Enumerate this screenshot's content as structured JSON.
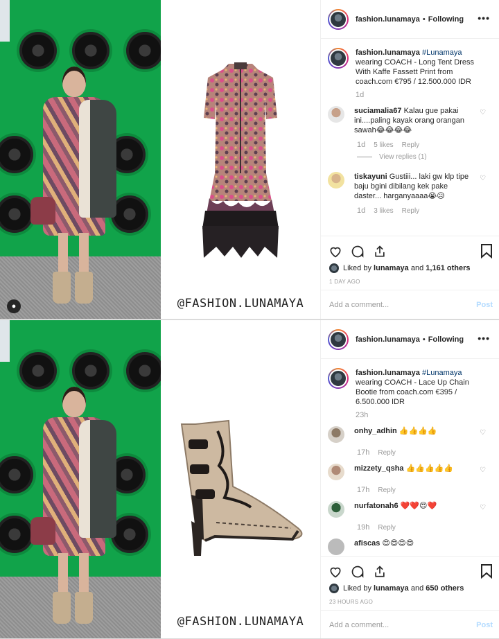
{
  "posts": [
    {
      "header": {
        "username": "fashion.lunamaya",
        "separator": "•",
        "follow_status": "Following",
        "more": "•••"
      },
      "watermark": "@FASHION.LUNAMAYA",
      "caption": {
        "username": "fashion.lunamaya",
        "hashtag": "#Lunamaya",
        "text": "wearing COACH - Long Tent Dress With Kaffe Fassett Print from coach.com €795 / 12.500.000 IDR",
        "time": "1d"
      },
      "comments": [
        {
          "username": "suciamalia67",
          "text": "Kalau gue pakai ini....paling kayak orang orangan sawah😂😂😂😂",
          "time": "1d",
          "likes": "5 likes",
          "reply": "Reply",
          "view_replies": "View replies (1)"
        },
        {
          "username": "tiskayuni",
          "text": "Gustiii... laki gw klp tipe baju bgini dibilang kek pake daster... harganyaaaa😭😥",
          "time": "1d",
          "likes": "3 likes",
          "reply": "Reply"
        }
      ],
      "liked_by_prefix": "Liked by",
      "liked_by_user": "lunamaya",
      "liked_by_and": "and",
      "liked_by_others": "1,161 others",
      "post_time": "1 DAY AGO",
      "add_comment_placeholder": "Add a comment...",
      "post_button": "Post"
    },
    {
      "header": {
        "username": "fashion.lunamaya",
        "separator": "•",
        "follow_status": "Following",
        "more": "•••"
      },
      "watermark": "@FASHION.LUNAMAYA",
      "caption": {
        "username": "fashion.lunamaya",
        "hashtag": "#Lunamaya",
        "text": "wearing COACH - Lace Up Chain Bootie from coach.com €395 / 6.500.000 IDR",
        "time": "23h"
      },
      "comments": [
        {
          "username": "onhy_adhin",
          "text": "👍👍👍👍",
          "time": "17h",
          "reply": "Reply"
        },
        {
          "username": "mizzety_qsha",
          "text": "👍👍👍👍👍",
          "time": "17h",
          "reply": "Reply"
        },
        {
          "username": "nurfatonah6",
          "text": "❤️❤️😍❤️",
          "time": "19h",
          "reply": "Reply"
        },
        {
          "username": "afiscas",
          "text": "😍😍😍😍",
          "time": "",
          "reply": ""
        }
      ],
      "liked_by_prefix": "Liked by",
      "liked_by_user": "lunamaya",
      "liked_by_and": "and",
      "liked_by_others": "650 others",
      "post_time": "23 HOURS AGO",
      "add_comment_placeholder": "Add a comment...",
      "post_button": "Post"
    }
  ],
  "colors": {
    "accent_green": "#11a34a",
    "link_blue": "#003569",
    "post_btn_disabled": "#b3dbff",
    "muted": "#999999"
  },
  "icons": [
    "heart-icon",
    "comment-icon",
    "share-icon",
    "bookmark-icon",
    "more-icon",
    "profile-icon"
  ]
}
